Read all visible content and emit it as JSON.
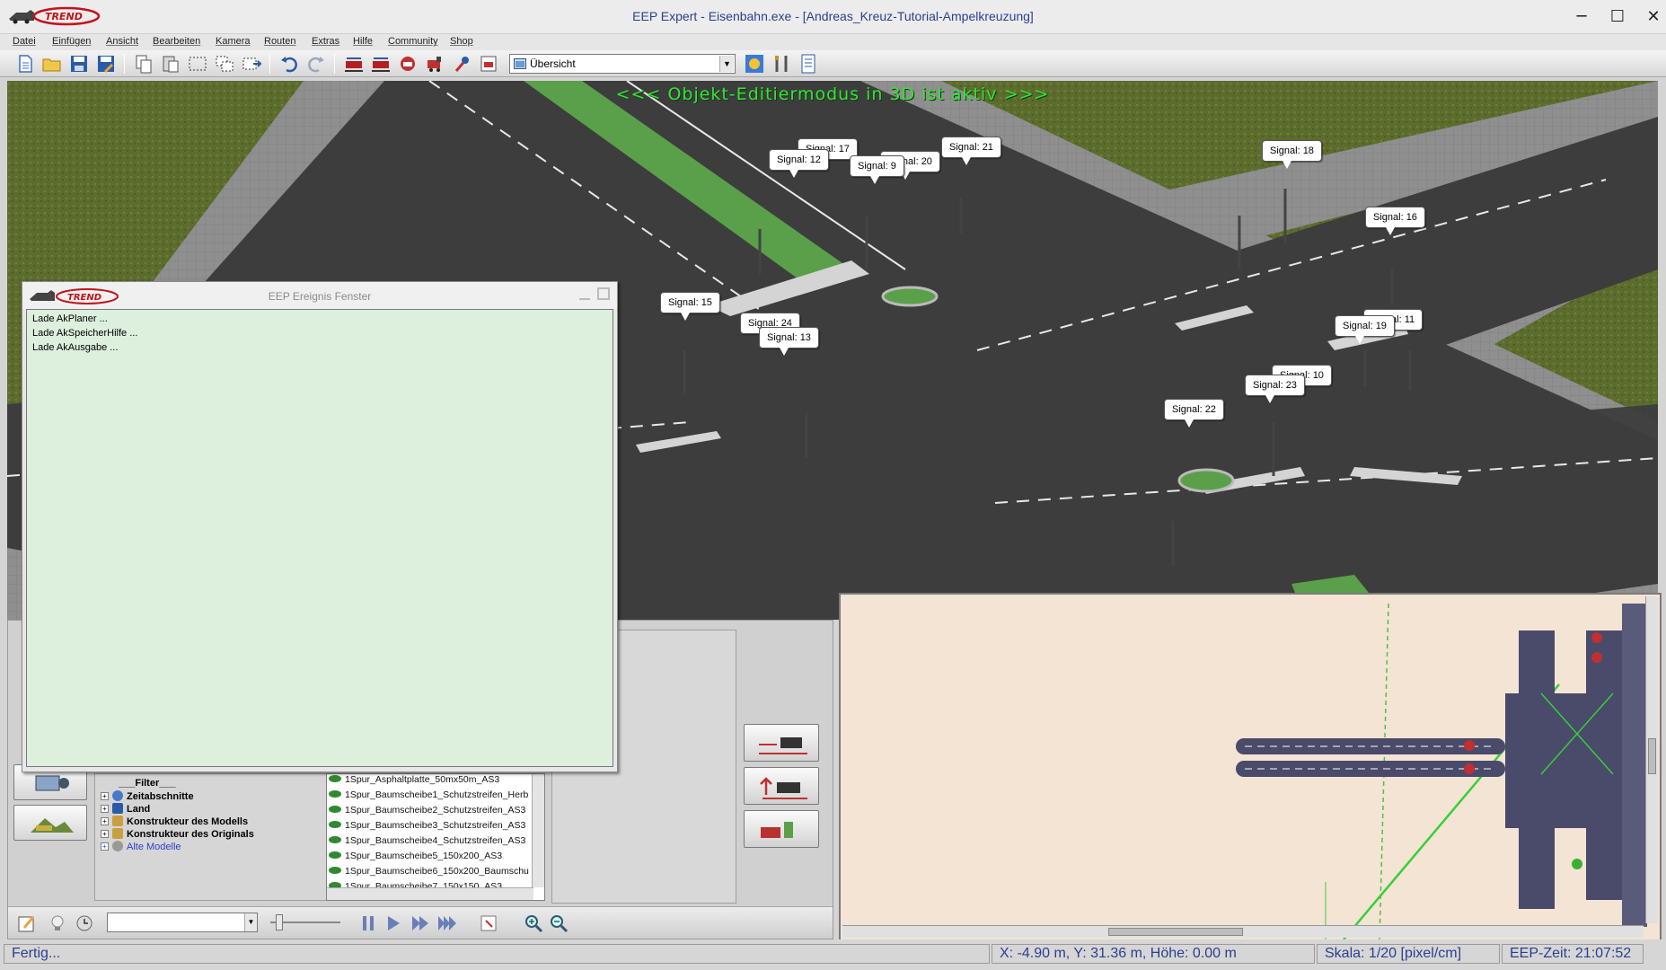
{
  "window": {
    "title": "EEP Expert - Eisenbahn.exe - [Andreas_Kreuz-Tutorial-Ampelkreuzung]",
    "logo_text": "TREND",
    "minimize": "─",
    "maximize": "☐",
    "close": "✕"
  },
  "menu": [
    "Datei",
    "Einfügen",
    "Ansicht",
    "Bearbeiten",
    "Kamera",
    "Routen",
    "Extras",
    "Hilfe",
    "Community",
    "Shop"
  ],
  "toolbar": {
    "view_select": "Übersicht",
    "icons": [
      "new-file-icon",
      "open-folder-icon",
      "save-icon",
      "save-as-icon",
      "copy-icon",
      "paste-icon",
      "select-rect-icon",
      "multi-select-icon",
      "move-icon",
      "undo-icon",
      "redo-icon",
      "train-route-icon",
      "train-route2-icon",
      "train-edit-icon",
      "loco-icon",
      "signal-icon",
      "export-icon",
      "weather-icon",
      "tools-icon",
      "lua-icon"
    ]
  },
  "viewport": {
    "banner": "<<<  Objekt-Editiermodus in 3D ist aktiv  >>>",
    "signals": [
      "Signal: 17",
      "Signal: 12",
      "Signal: 9",
      "Signal: 20",
      "Signal: 21",
      "Signal: 18",
      "Signal: 16",
      "Signal: 15",
      "Signal: 24",
      "Signal: 13",
      "Signal: 19",
      "Signal: 11",
      "Signal: 10",
      "Signal: 23",
      "Signal: 22"
    ]
  },
  "event_window": {
    "title": "EEP Ereignis Fenster",
    "lines": [
      "Lade AkPlaner ...",
      "Lade AkSpeicherHilfe ...",
      "Lade AkAusgabe ..."
    ]
  },
  "tree": {
    "filter": "___Filter___",
    "items": [
      {
        "label": "Zeitabschnitte",
        "icon": "clock-icon",
        "bold": true
      },
      {
        "label": "Land",
        "icon": "land-icon",
        "bold": true
      },
      {
        "label": "Konstrukteur des Modells",
        "icon": "builder-icon",
        "bold": true
      },
      {
        "label": "Konstrukteur des Originals",
        "icon": "builder-icon",
        "bold": true
      },
      {
        "label": "Alte Modelle",
        "icon": "gear-icon",
        "bold": false
      }
    ]
  },
  "model_list": [
    "1Spur_Asphaltplatte_50mx50m_AS3",
    "1Spur_Baumscheibe1_Schutzstreifen_Herb",
    "1Spur_Baumscheibe2_Schutzstreifen_AS3",
    "1Spur_Baumscheibe3_Schutzstreifen_AS3",
    "1Spur_Baumscheibe4_Schutzstreifen_AS3",
    "1Spur_Baumscheibe5_150x200_AS3",
    "1Spur_Baumscheibe6_150x200_Baumschu",
    "1Spur_Baumscheibe7_150x150_AS3"
  ],
  "status": {
    "left": "Fertig...",
    "coords": "X: -4.90 m, Y: 31.36 m, Höhe: 0.00 m",
    "scale": "Skala: 1/20 [pixel/cm]",
    "time": "EEP-Zeit: 21:07:52"
  },
  "colors": {
    "banner": "#39e23a",
    "event_bg": "#ddefdd",
    "map_bg": "#f4e4d4",
    "road": "#3f3f3f",
    "grass": "#5a6b2c",
    "status_text": "#2a3f8f"
  }
}
